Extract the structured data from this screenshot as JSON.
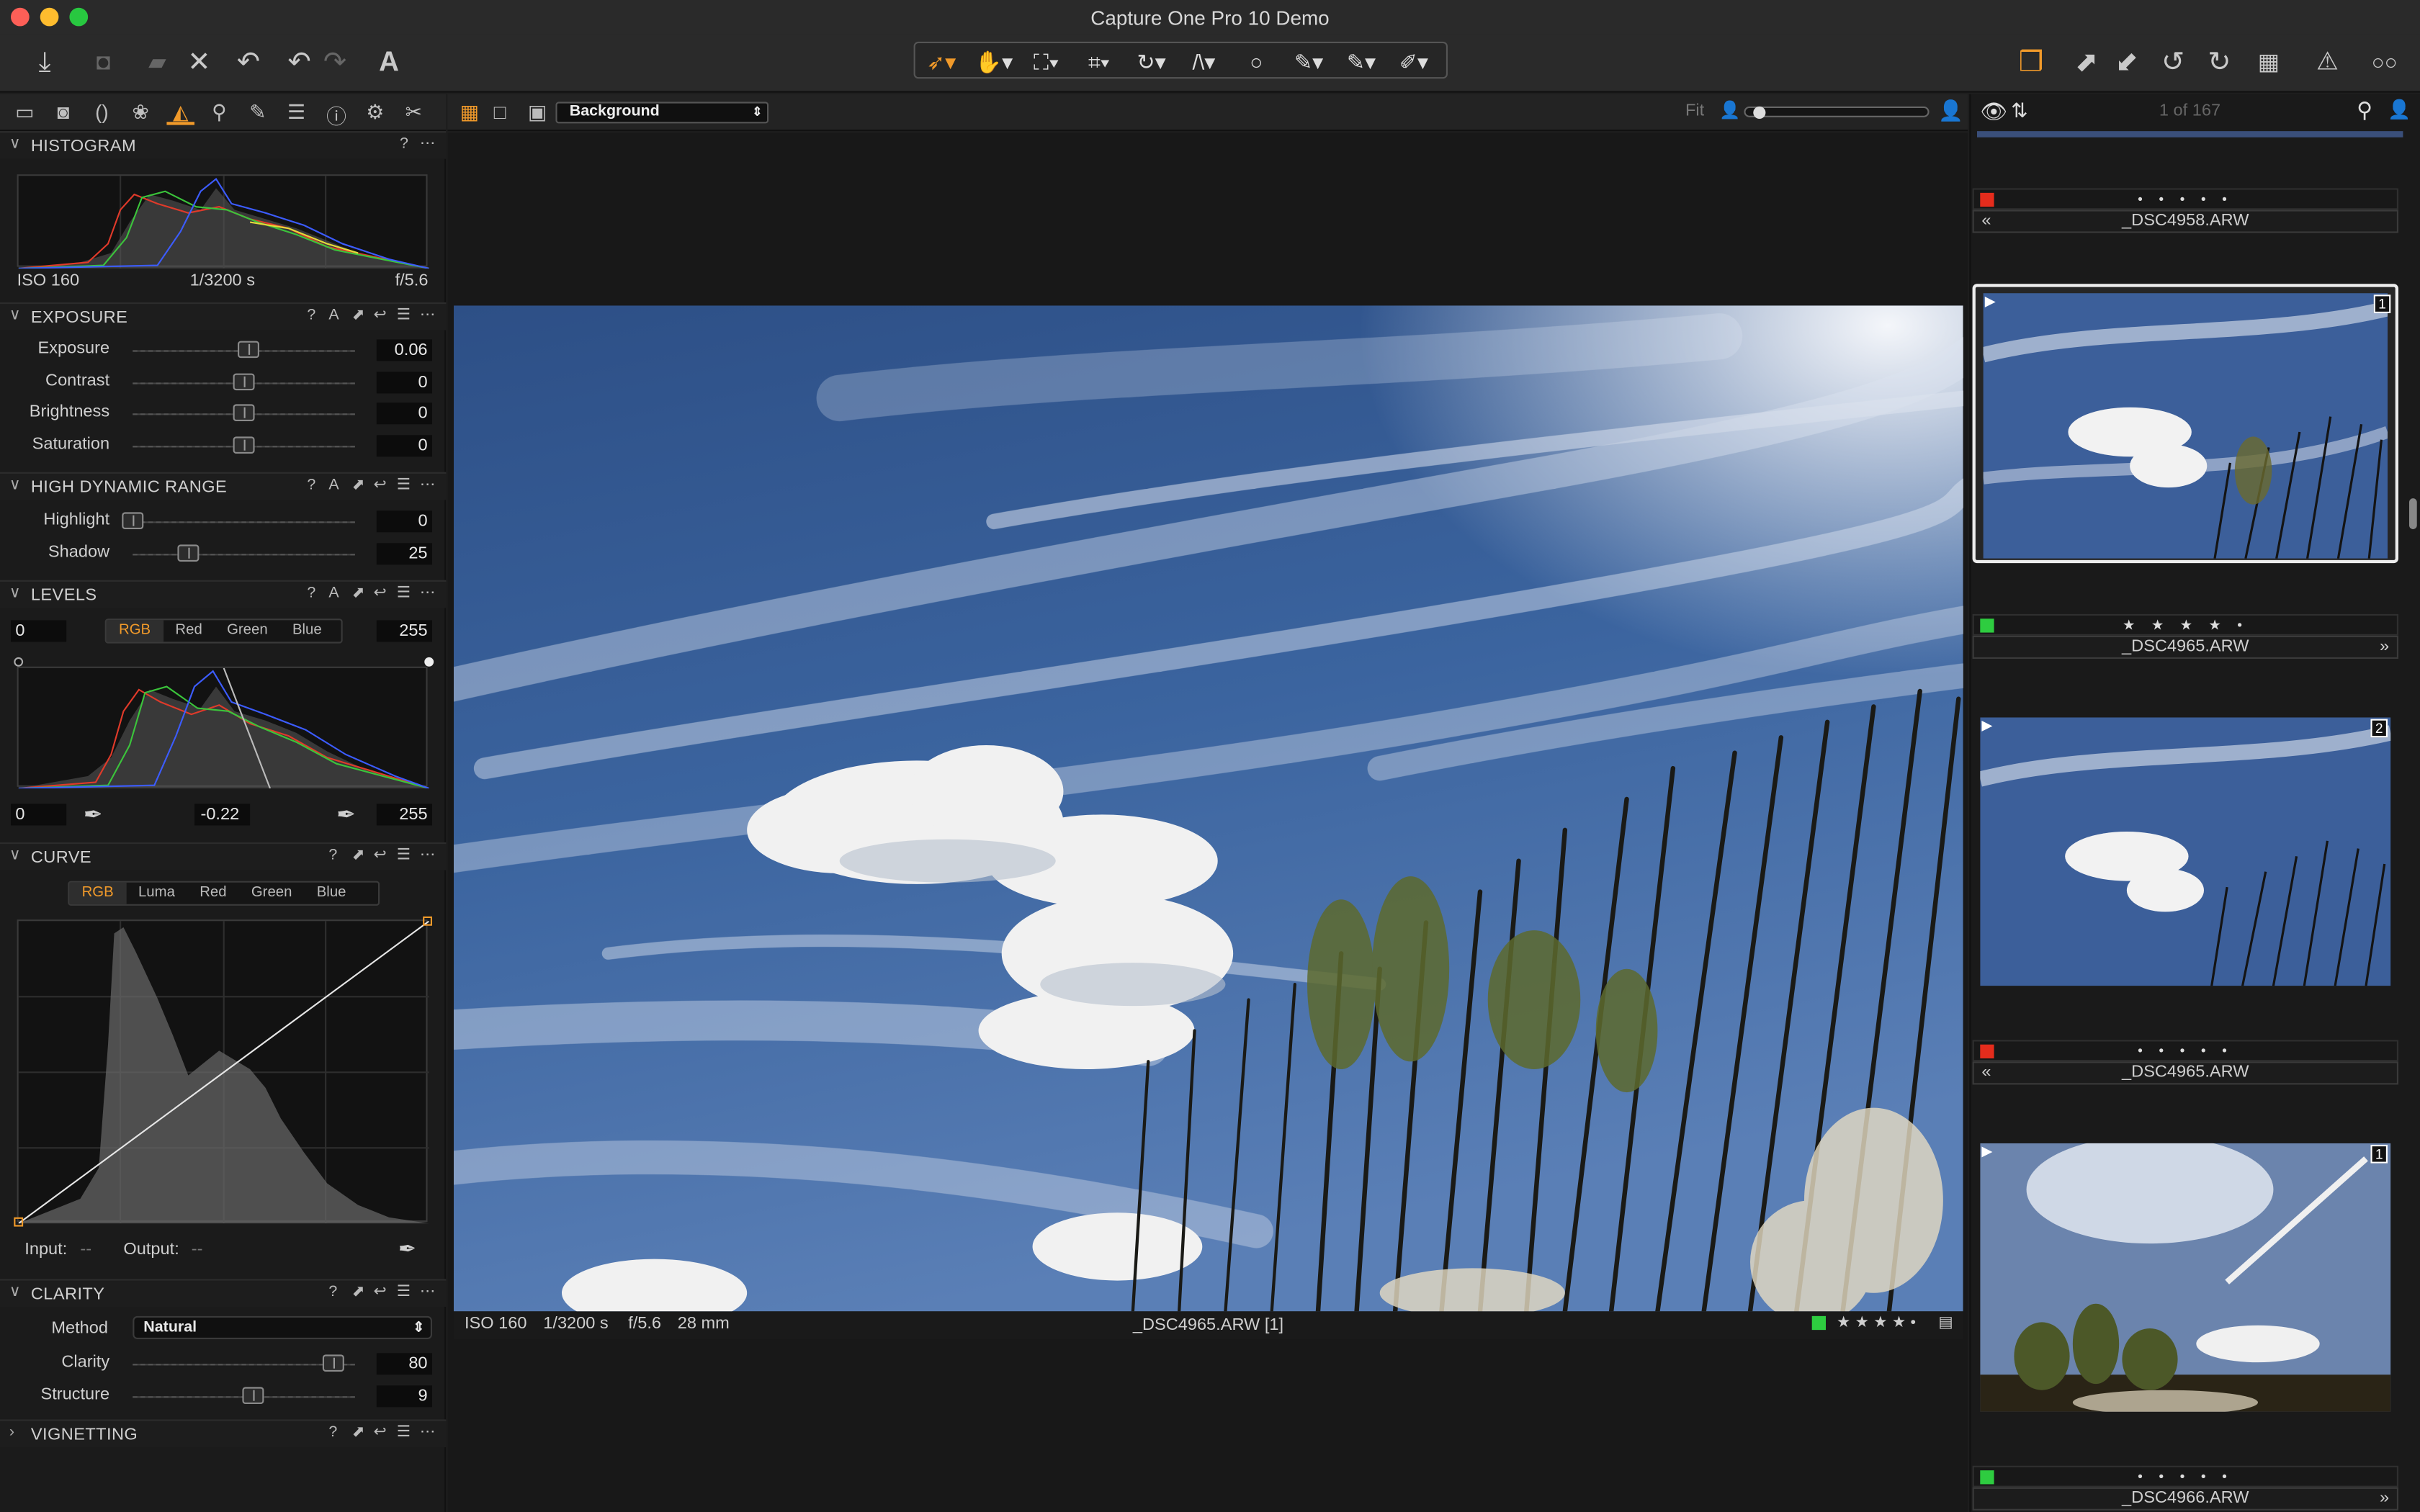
{
  "window": {
    "title": "Capture One Pro 10 Demo"
  },
  "toolbar": {
    "left_icons": [
      "import-icon",
      "camera-icon",
      "folder-move-icon",
      "delete-icon",
      "undo-history-icon",
      "undo-icon",
      "redo-icon",
      "text-tool-icon"
    ],
    "cursor_tools": [
      "pointer-tool-icon",
      "pan-tool-icon",
      "loupe-tool-icon",
      "crop-tool-icon",
      "rotate-tool-icon",
      "keystone-tool-icon",
      "spot-removal-tool-icon",
      "brush-tool-icon",
      "eraser-tool-icon",
      "picker-tool-icon"
    ],
    "right_icons": [
      "variants-icon",
      "copy-adjustments-icon",
      "apply-adjustments-icon",
      "rotate-left-icon",
      "rotate-right-icon",
      "grid-icon",
      "exposure-warning-icon",
      "proof-glasses-icon"
    ]
  },
  "left_tabs": [
    "library-tab-icon",
    "capture-tab-icon",
    "lens-tab-icon",
    "color-tab-icon",
    "exposure-tab-icon",
    "details-tab-icon",
    "local-adjustments-tab-icon",
    "metadata-tab-icon",
    "output-tab-icon",
    "batch-tab-icon",
    "settings-tab-icon",
    "tool-tab-icon"
  ],
  "histogram": {
    "title": "HISTOGRAM",
    "iso": "ISO 160",
    "shutter": "1/3200 s",
    "aperture": "f/5.6"
  },
  "exposure": {
    "title": "EXPOSURE",
    "rows": [
      {
        "label": "Exposure",
        "value": "0.06",
        "level": 0.52
      },
      {
        "label": "Contrast",
        "value": "0",
        "level": 0.5
      },
      {
        "label": "Brightness",
        "value": "0",
        "level": 0.5
      },
      {
        "label": "Saturation",
        "value": "0",
        "level": 0.5
      }
    ]
  },
  "hdr": {
    "title": "HIGH DYNAMIC RANGE",
    "rows": [
      {
        "label": "Highlight",
        "value": "0",
        "level": 0.0
      },
      {
        "label": "Shadow",
        "value": "25",
        "level": 0.25
      }
    ]
  },
  "levels": {
    "title": "LEVELS",
    "in_low": "0",
    "in_high": "255",
    "out_low": "0",
    "mid": "-0.22",
    "out_high": "255",
    "channels": [
      "RGB",
      "Red",
      "Green",
      "Blue"
    ],
    "active": "RGB"
  },
  "curve": {
    "title": "CURVE",
    "channels": [
      "RGB",
      "Luma",
      "Red",
      "Green",
      "Blue"
    ],
    "active": "RGB",
    "input_label": "Input:",
    "input_value": "--",
    "output_label": "Output:",
    "output_value": "--"
  },
  "clarity": {
    "title": "CLARITY",
    "method_label": "Method",
    "method_value": "Natural",
    "rows": [
      {
        "label": "Clarity",
        "value": "80",
        "level": 0.9
      },
      {
        "label": "Structure",
        "value": "9",
        "level": 0.54
      }
    ]
  },
  "vignetting": {
    "title": "VIGNETTING"
  },
  "viewer": {
    "layer": "Background",
    "fit_label": "Fit",
    "counter": "1 of 167"
  },
  "info_bar": {
    "iso": "ISO 160",
    "shutter": "1/3200 s",
    "aperture": "f/5.6",
    "focal": "28 mm",
    "filename": "_DSC4965.ARW [1]"
  },
  "browser": {
    "items": [
      {
        "name": "_DSC4958.ARW",
        "rating": "• • • • •",
        "tag_color": "#e52c1c",
        "badge": ""
      },
      {
        "name": "_DSC4965.ARW",
        "rating": "★ ★ ★ ★ •",
        "tag_color": "#2ecc40",
        "badge": "1"
      },
      {
        "name": "_DSC4965.ARW",
        "rating": "• • • • •",
        "tag_color": "#e52c1c",
        "badge": "2"
      },
      {
        "name": "_DSC4966.ARW",
        "rating": "• • • • •",
        "tag_color": "#2ecc40",
        "badge": "1"
      }
    ]
  },
  "colors": {
    "accent": "#f19a2a",
    "panel": "#1b1b1b",
    "green_tag": "#2ecc40",
    "red_tag": "#e52c1c"
  }
}
